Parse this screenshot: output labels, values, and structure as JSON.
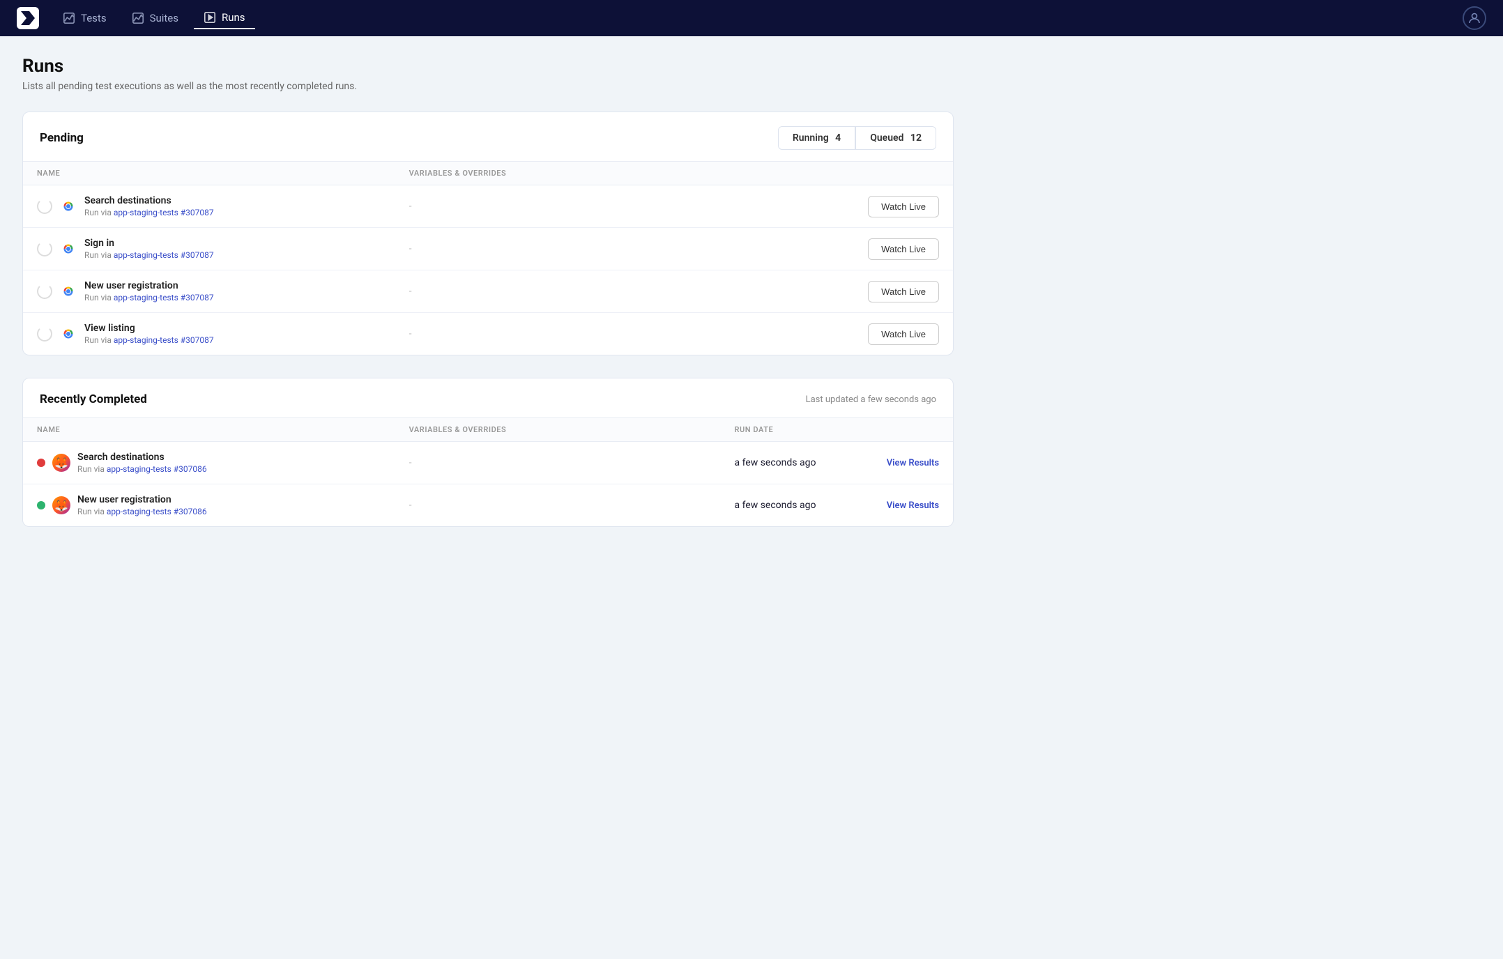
{
  "nav": {
    "logo_label": "Logo",
    "items": [
      {
        "id": "tests",
        "label": "Tests",
        "active": false
      },
      {
        "id": "suites",
        "label": "Suites",
        "active": false
      },
      {
        "id": "runs",
        "label": "Runs",
        "active": true
      }
    ]
  },
  "page": {
    "title": "Runs",
    "subtitle": "Lists all pending test executions as well as the most recently completed runs."
  },
  "pending": {
    "section_title": "Pending",
    "running_label": "Running",
    "running_count": "4",
    "queued_label": "Queued",
    "queued_count": "12",
    "columns": {
      "name": "NAME",
      "variables": "VARIABLES & OVERRIDES"
    },
    "rows": [
      {
        "id": "row-search-destinations",
        "name": "Search destinations",
        "run_via_text": "Run via",
        "run_link_label": "app-staging-tests #307087",
        "run_link_href": "#",
        "variables": "-",
        "watch_label": "Watch Live",
        "browser": "chrome"
      },
      {
        "id": "row-sign-in",
        "name": "Sign in",
        "run_via_text": "Run via",
        "run_link_label": "app-staging-tests #307087",
        "run_link_href": "#",
        "variables": "-",
        "watch_label": "Watch Live",
        "browser": "chrome"
      },
      {
        "id": "row-new-user-reg",
        "name": "New user registration",
        "run_via_text": "Run via",
        "run_link_label": "app-staging-tests #307087",
        "run_link_href": "#",
        "variables": "-",
        "watch_label": "Watch Live",
        "browser": "chrome"
      },
      {
        "id": "row-view-listing",
        "name": "View listing",
        "run_via_text": "Run via",
        "run_link_label": "app-staging-tests #307087",
        "run_link_href": "#",
        "variables": "-",
        "watch_label": "Watch Live",
        "browser": "chrome"
      }
    ]
  },
  "recently_completed": {
    "section_title": "Recently Completed",
    "last_updated_label": "Last updated a few seconds ago",
    "columns": {
      "name": "NAME",
      "variables": "VARIABLES & OVERRIDES",
      "run_date": "RUN DATE"
    },
    "rows": [
      {
        "id": "rc-search-destinations",
        "name": "Search destinations",
        "run_via_text": "Run via",
        "run_link_label": "app-staging-tests #307086",
        "run_link_href": "#",
        "variables": "-",
        "run_date": "a few seconds ago",
        "view_results_label": "View Results",
        "status": "failed",
        "browser": "firefox"
      },
      {
        "id": "rc-new-user-reg",
        "name": "New user registration",
        "run_via_text": "Run via",
        "run_link_label": "app-staging-tests #307086",
        "run_link_href": "#",
        "variables": "-",
        "run_date": "a few seconds ago",
        "view_results_label": "View Results",
        "status": "passed",
        "browser": "firefox"
      }
    ]
  }
}
